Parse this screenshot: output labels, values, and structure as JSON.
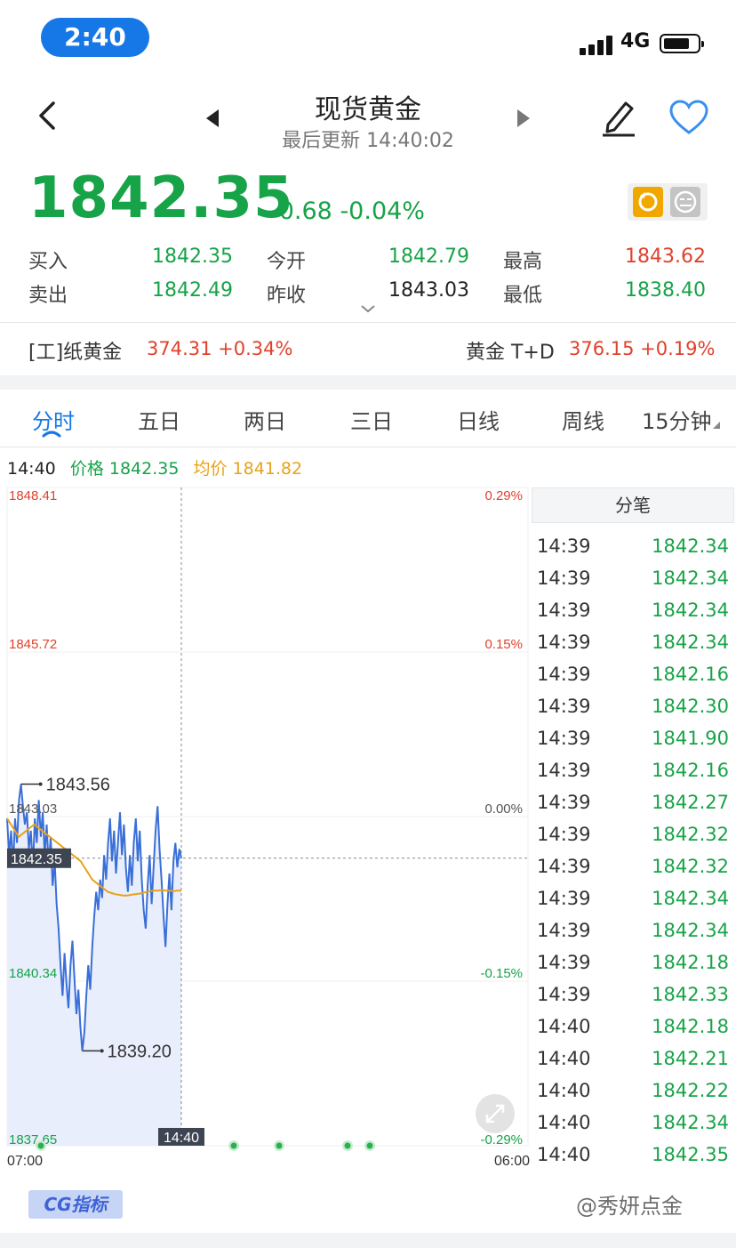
{
  "status": {
    "time": "2:40",
    "network": "4G"
  },
  "header": {
    "title": "现货黄金",
    "subtitle": "最后更新 14:40:02"
  },
  "price": {
    "last": "1842.35",
    "change": "-0.68 -0.04%"
  },
  "quote": {
    "buy_label": "买入",
    "buy": "1842.35",
    "sell_label": "卖出",
    "sell": "1842.49",
    "open_label": "今开",
    "open": "1842.79",
    "prevclose_label": "昨收",
    "prevclose": "1843.03",
    "high_label": "最高",
    "high": "1843.62",
    "low_label": "最低",
    "low": "1838.40"
  },
  "related": [
    {
      "name": "[工]纸黄金",
      "value": "374.31 +0.34%"
    },
    {
      "name": "黄金 T+D",
      "value": "376.15 +0.19%"
    }
  ],
  "tabs": [
    "分时",
    "五日",
    "两日",
    "三日",
    "日线",
    "周线",
    "15分钟"
  ],
  "legend": {
    "time": "14:40",
    "price": "价格 1842.35",
    "avg": "均价 1841.82"
  },
  "chart_data": {
    "type": "line",
    "y_left_ticks": [
      "1848.41",
      "1845.72",
      "1843.03",
      "1840.34",
      "1837.65"
    ],
    "y_right_ticks": [
      "0.29%",
      "0.15%",
      "0.00%",
      "-0.15%",
      "-0.29%"
    ],
    "x_ticks": [
      "07:00",
      "06:00"
    ],
    "ylim": [
      1837.65,
      1848.41
    ],
    "reference": 1843.03,
    "current_price_label": "1842.35",
    "current_time_label": "14:40",
    "max_label": "1843.56",
    "min_label": "1839.20",
    "series": [
      {
        "name": "价格",
        "color": "#3a6fd8",
        "values": [
          1843.0,
          1842.4,
          1842.8,
          1842.2,
          1843.0,
          1842.6,
          1843.3,
          1843.56,
          1843.2,
          1842.9,
          1843.1,
          1842.5,
          1842.8,
          1842.2,
          1843.0,
          1842.6,
          1843.3,
          1842.7,
          1843.1,
          1842.4,
          1842.9,
          1842.2,
          1842.7,
          1841.9,
          1842.3,
          1841.6,
          1841.2,
          1840.6,
          1840.1,
          1840.8,
          1840.3,
          1839.9,
          1840.6,
          1841.0,
          1840.4,
          1839.8,
          1840.2,
          1839.6,
          1839.2,
          1839.5,
          1840.1,
          1840.6,
          1840.2,
          1840.9,
          1841.4,
          1841.8,
          1841.5,
          1842.0,
          1841.7,
          1842.4,
          1842.0,
          1842.6,
          1843.0,
          1842.3,
          1842.8,
          1842.1,
          1842.6,
          1843.1,
          1842.4,
          1842.9,
          1842.2,
          1841.8,
          1842.4,
          1841.9,
          1842.6,
          1843.0,
          1842.3,
          1842.8,
          1842.0,
          1841.5,
          1841.2,
          1841.9,
          1842.4,
          1841.6,
          1842.2,
          1842.8,
          1843.2,
          1842.5,
          1842.0,
          1841.4,
          1840.9,
          1841.6,
          1842.1,
          1841.5,
          1842.3,
          1842.6,
          1842.2,
          1842.5,
          1842.35
        ]
      },
      {
        "name": "均价",
        "color": "#e8a21a",
        "values": [
          1843.0,
          1842.9,
          1842.8,
          1842.7,
          1842.75,
          1842.8,
          1842.85,
          1842.9,
          1842.85,
          1842.8,
          1842.75,
          1842.7,
          1842.65,
          1842.6,
          1842.55,
          1842.5,
          1842.45,
          1842.4,
          1842.35,
          1842.3,
          1842.2,
          1842.1,
          1842.0,
          1841.95,
          1841.9,
          1841.85,
          1841.8,
          1841.78,
          1841.76,
          1841.75,
          1841.74,
          1841.74,
          1841.75,
          1841.76,
          1841.77,
          1841.78,
          1841.8,
          1841.81,
          1841.82,
          1841.82,
          1841.83,
          1841.82,
          1841.82,
          1841.81,
          1841.82,
          1841.82
        ]
      }
    ]
  },
  "ticks": {
    "title": "分笔",
    "rows": [
      {
        "time": "14:39",
        "price": "1842.34"
      },
      {
        "time": "14:39",
        "price": "1842.34"
      },
      {
        "time": "14:39",
        "price": "1842.34"
      },
      {
        "time": "14:39",
        "price": "1842.34"
      },
      {
        "time": "14:39",
        "price": "1842.16"
      },
      {
        "time": "14:39",
        "price": "1842.30"
      },
      {
        "time": "14:39",
        "price": "1841.90"
      },
      {
        "time": "14:39",
        "price": "1842.16"
      },
      {
        "time": "14:39",
        "price": "1842.27"
      },
      {
        "time": "14:39",
        "price": "1842.32"
      },
      {
        "time": "14:39",
        "price": "1842.32"
      },
      {
        "time": "14:39",
        "price": "1842.34"
      },
      {
        "time": "14:39",
        "price": "1842.34"
      },
      {
        "time": "14:39",
        "price": "1842.18"
      },
      {
        "time": "14:39",
        "price": "1842.33"
      },
      {
        "time": "14:40",
        "price": "1842.18"
      },
      {
        "time": "14:40",
        "price": "1842.21"
      },
      {
        "time": "14:40",
        "price": "1842.22"
      },
      {
        "time": "14:40",
        "price": "1842.34"
      },
      {
        "time": "14:40",
        "price": "1842.35"
      }
    ]
  },
  "footer": {
    "indicator_button": "CG指标",
    "watermark": "@秀妍点金"
  }
}
